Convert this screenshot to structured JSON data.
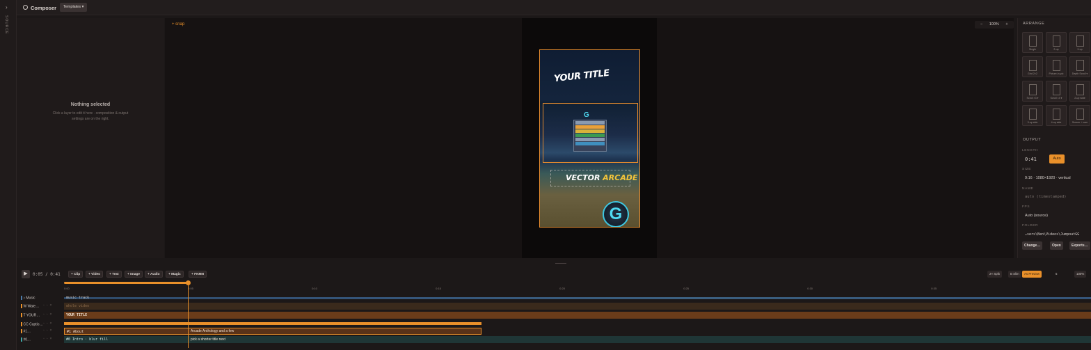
{
  "rail": {
    "toggle": "›",
    "label": "SOURCE"
  },
  "topbar": {
    "app_name": "Composer",
    "templates_label": "Templates ▾"
  },
  "info": {
    "heading": "Nothing selected",
    "sub": "Click a layer to edit it here · composition & output settings are on the right."
  },
  "canvas": {
    "snap_label": "+ snap",
    "zoom": {
      "minus": "−",
      "value": "100%",
      "plus": "+"
    },
    "preview": {
      "title": "YOUR TITLE",
      "brand_a": "VECTOR",
      "brand_b": "ARCADE",
      "logo_letter": "G"
    }
  },
  "arrange": {
    "heading": "ARRANGE",
    "tiles": [
      "Single",
      "2-up",
      "3-up",
      "Grid 2×2",
      "Picture-in-pic",
      "Depth Scroll ▾",
      "Scroll ×3 ▾",
      "Scroll ×4 ▾",
      "2-up wide",
      "3-up side",
      "4-up side",
      "Screen + cam"
    ]
  },
  "output": {
    "heading": "OUTPUT",
    "length_label": "LENGTH",
    "length_value": "0:41",
    "auto_label": "Auto",
    "size_label": "SIZE",
    "size_value": "9:16 · 1080×1920 · vertical",
    "name_label": "NAME",
    "name_value": "auto (timestamped)",
    "fps_label": "FPS",
    "fps_value": "Auto (source)",
    "folder_label": "FOLDER",
    "folder_value": "…sers\\Ben\\Videos\\JumpoutGG",
    "buttons": [
      "Change…",
      "Open",
      "Exports…"
    ]
  },
  "timeline": {
    "play": "▶",
    "time_current": "0:05",
    "time_total": "/ 0:41",
    "add_buttons": [
      "+ Clip",
      "+ Video",
      "+ Text",
      "+ Image",
      "+ Audio",
      "+ Magic",
      "+ FKMN"
    ],
    "right_buttons": [
      "2× Split",
      "B Slim",
      "As Preview"
    ],
    "zoom_value": "5",
    "zoom_pct": "100%",
    "ticks": [
      "0:00",
      "0:05",
      "0:10",
      "0:15",
      "0:20",
      "0:25",
      "0:30",
      "0:35"
    ],
    "progress": 0.12,
    "tracks": [
      {
        "label": "♪ Music",
        "clip": "music track",
        "color": "#4c7aa8"
      },
      {
        "label": "W Wate…",
        "clip": "whole video",
        "color": "#e9902a"
      },
      {
        "label": "T YOUR…",
        "clip": "YOUR TITLE",
        "color": "#e9902a"
      },
      {
        "label": "CC Captio…",
        "clip": "",
        "color": "#e9902a"
      },
      {
        "label": "#1…",
        "clip": "#1 About",
        "clip2": "Arcade Anthology and a few",
        "color": "#e9902a"
      },
      {
        "label": "#0…",
        "clip": "#0 Intro · blur fill",
        "clip2": "pick a shorter title next",
        "color": "#3fa8a8"
      }
    ]
  }
}
